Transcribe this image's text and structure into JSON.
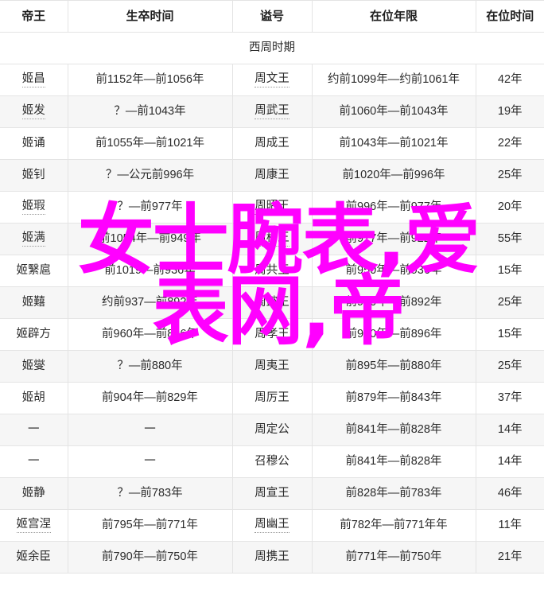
{
  "table": {
    "columns": [
      "帝王",
      "生卒时间",
      "谥号",
      "在位年限",
      "在位时间"
    ],
    "section_label": "西周时期",
    "rows": [
      {
        "name": "姬昌",
        "name_link": true,
        "life": "前1152年—前1056年",
        "posthumous": "周文王",
        "posthumous_link": true,
        "reign": "约前1099年—约前1061年",
        "years": "42年"
      },
      {
        "name": "姬发",
        "name_link": true,
        "life": "？—前1043年",
        "posthumous": "周武王",
        "posthumous_link": true,
        "reign": "前1060年—前1043年",
        "years": "19年"
      },
      {
        "name": "姬诵",
        "name_link": false,
        "life": "前1055年—前1021年",
        "posthumous": "周成王",
        "posthumous_link": false,
        "reign": "前1043年—前1021年",
        "years": "22年"
      },
      {
        "name": "姬钊",
        "name_link": false,
        "life": "？—公元前996年",
        "posthumous": "周康王",
        "posthumous_link": false,
        "reign": "前1020年—前996年",
        "years": "25年"
      },
      {
        "name": "姬瑕",
        "name_link": true,
        "life": "？—前977年",
        "posthumous": "周昭王",
        "posthumous_link": true,
        "reign": "前996年—前977年",
        "years": "20年"
      },
      {
        "name": "姬满",
        "name_link": true,
        "life": "前1054年—前949年",
        "posthumous": "周穆王",
        "posthumous_link": true,
        "reign": "前977年—前922年",
        "years": "55年"
      },
      {
        "name": "姬繄扈",
        "name_link": false,
        "life": "前1019—前936年",
        "posthumous": "周共王",
        "posthumous_link": false,
        "reign": "前950年—前936年",
        "years": "15年"
      },
      {
        "name": "姬囏",
        "name_link": false,
        "life": "约前937—前892年",
        "posthumous": "周懿王",
        "posthumous_link": false,
        "reign": "前900年—前892年",
        "years": "25年"
      },
      {
        "name": "姬辟方",
        "name_link": false,
        "life": "前960年—前896年",
        "posthumous": "周孝王",
        "posthumous_link": false,
        "reign": "前910年—前896年",
        "years": "15年"
      },
      {
        "name": "姬燮",
        "name_link": false,
        "life": "？—前880年",
        "posthumous": "周夷王",
        "posthumous_link": false,
        "reign": "前895年—前880年",
        "years": "25年"
      },
      {
        "name": "姬胡",
        "name_link": false,
        "life": "前904年—前829年",
        "posthumous": "周厉王",
        "posthumous_link": false,
        "reign": "前879年—前843年",
        "years": "37年"
      },
      {
        "name": "一",
        "name_link": false,
        "life": "一",
        "posthumous": "周定公",
        "posthumous_link": false,
        "reign": "前841年—前828年",
        "years": "14年"
      },
      {
        "name": "一",
        "name_link": false,
        "life": "一",
        "posthumous": "召穆公",
        "posthumous_link": false,
        "reign": "前841年—前828年",
        "years": "14年"
      },
      {
        "name": "姬静",
        "name_link": false,
        "life": "？—前783年",
        "posthumous": "周宣王",
        "posthumous_link": false,
        "reign": "前828年—前783年",
        "years": "46年"
      },
      {
        "name": "姬宫涅",
        "name_link": true,
        "life": "前795年—前771年",
        "posthumous": "周幽王",
        "posthumous_link": true,
        "reign": "前782年—前771年年",
        "years": "11年"
      },
      {
        "name": "姬余臣",
        "name_link": false,
        "life": "前790年—前750年",
        "posthumous": "周携王",
        "posthumous_link": false,
        "reign": "前771年—前750年",
        "years": "21年"
      }
    ]
  },
  "watermark": {
    "text": "女士腕表,爱\n表网,帝",
    "color": "#ff00ff"
  }
}
